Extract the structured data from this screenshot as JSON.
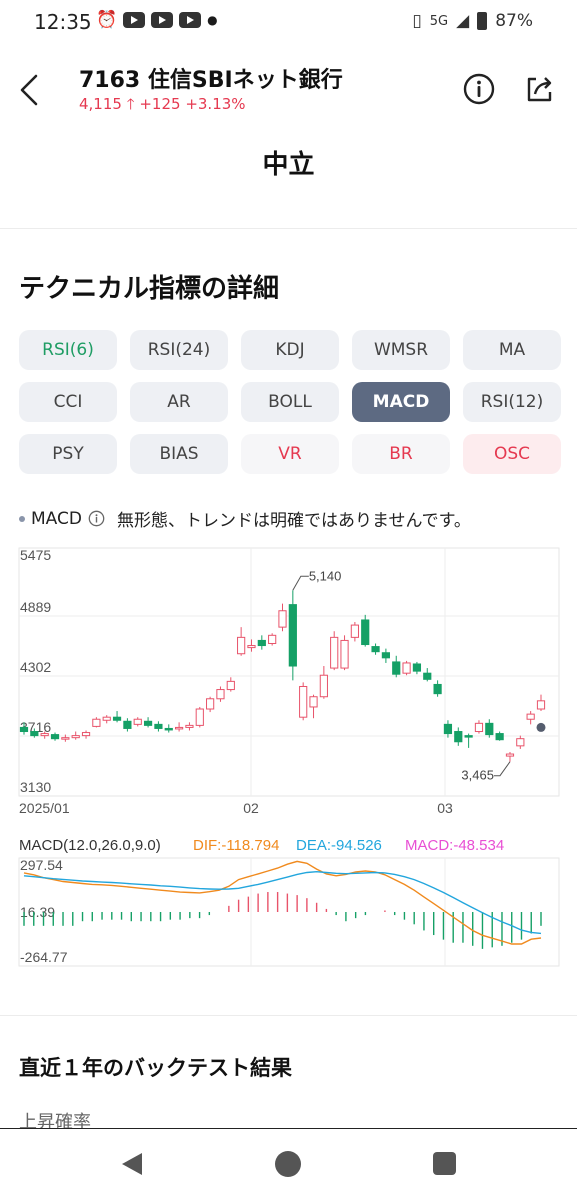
{
  "status_bar": {
    "time": "12:35",
    "network": "5G",
    "battery": "87%"
  },
  "header": {
    "title": "7163 住信SBIネット銀行",
    "price": "4,115",
    "change": "+125",
    "change_pct": "+3.13%",
    "rating": "中立"
  },
  "section_title": "テクニカル指標の詳細",
  "indicators": [
    {
      "label": "RSI(6)",
      "state": "green"
    },
    {
      "label": "RSI(24)",
      "state": "neutral"
    },
    {
      "label": "KDJ",
      "state": "neutral"
    },
    {
      "label": "WMSR",
      "state": "neutral"
    },
    {
      "label": "MA",
      "state": "neutral"
    },
    {
      "label": "CCI",
      "state": "neutral"
    },
    {
      "label": "AR",
      "state": "neutral"
    },
    {
      "label": "BOLL",
      "state": "neutral"
    },
    {
      "label": "MACD",
      "state": "active"
    },
    {
      "label": "RSI(12)",
      "state": "neutral"
    },
    {
      "label": "PSY",
      "state": "neutral"
    },
    {
      "label": "BIAS",
      "state": "neutral"
    },
    {
      "label": "VR",
      "state": "red"
    },
    {
      "label": "BR",
      "state": "red"
    },
    {
      "label": "OSC",
      "state": "pink"
    }
  ],
  "macd_status": {
    "name": "MACD",
    "text": "無形態、トレンドは明確ではありませんです。"
  },
  "chart_data": [
    {
      "type": "candlestick",
      "y_ticks": [
        "5475",
        "4889",
        "4302",
        "3716",
        "3130"
      ],
      "ylim": [
        3130,
        5475
      ],
      "x_ticks": [
        "2025/01",
        "02",
        "03"
      ],
      "annotations": [
        {
          "text": "5,140",
          "value": 5140
        },
        {
          "text": "3,465",
          "value": 3465
        }
      ],
      "colors": {
        "up": "#e8536a",
        "down": "#15a066"
      },
      "candles": [
        {
          "o": 3800,
          "h": 3850,
          "l": 3730,
          "c": 3760
        },
        {
          "o": 3760,
          "h": 3790,
          "l": 3700,
          "c": 3720
        },
        {
          "o": 3720,
          "h": 3760,
          "l": 3690,
          "c": 3740
        },
        {
          "o": 3730,
          "h": 3750,
          "l": 3670,
          "c": 3690
        },
        {
          "o": 3690,
          "h": 3730,
          "l": 3660,
          "c": 3700
        },
        {
          "o": 3700,
          "h": 3760,
          "l": 3680,
          "c": 3720
        },
        {
          "o": 3720,
          "h": 3770,
          "l": 3690,
          "c": 3750
        },
        {
          "o": 3810,
          "h": 3900,
          "l": 3800,
          "c": 3880
        },
        {
          "o": 3870,
          "h": 3920,
          "l": 3840,
          "c": 3900
        },
        {
          "o": 3900,
          "h": 3960,
          "l": 3850,
          "c": 3870
        },
        {
          "o": 3860,
          "h": 3890,
          "l": 3760,
          "c": 3790
        },
        {
          "o": 3830,
          "h": 3900,
          "l": 3810,
          "c": 3880
        },
        {
          "o": 3860,
          "h": 3900,
          "l": 3800,
          "c": 3820
        },
        {
          "o": 3830,
          "h": 3860,
          "l": 3760,
          "c": 3790
        },
        {
          "o": 3790,
          "h": 3830,
          "l": 3750,
          "c": 3780
        },
        {
          "o": 3790,
          "h": 3850,
          "l": 3760,
          "c": 3800
        },
        {
          "o": 3800,
          "h": 3850,
          "l": 3770,
          "c": 3820
        },
        {
          "o": 3820,
          "h": 4000,
          "l": 3800,
          "c": 3980
        },
        {
          "o": 3980,
          "h": 4100,
          "l": 3950,
          "c": 4080
        },
        {
          "o": 4080,
          "h": 4200,
          "l": 4050,
          "c": 4170
        },
        {
          "o": 4170,
          "h": 4290,
          "l": 4150,
          "c": 4250
        },
        {
          "o": 4520,
          "h": 4780,
          "l": 4500,
          "c": 4680
        },
        {
          "o": 4580,
          "h": 4660,
          "l": 4540,
          "c": 4600
        },
        {
          "o": 4650,
          "h": 4700,
          "l": 4560,
          "c": 4600
        },
        {
          "o": 4620,
          "h": 4720,
          "l": 4600,
          "c": 4700
        },
        {
          "o": 4780,
          "h": 5010,
          "l": 4740,
          "c": 4940
        },
        {
          "o": 5000,
          "h": 5140,
          "l": 4260,
          "c": 4400
        },
        {
          "o": 3900,
          "h": 4240,
          "l": 3870,
          "c": 4200
        },
        {
          "o": 4000,
          "h": 4120,
          "l": 3890,
          "c": 4100
        },
        {
          "o": 4100,
          "h": 4400,
          "l": 4080,
          "c": 4310
        },
        {
          "o": 4380,
          "h": 4740,
          "l": 4360,
          "c": 4680
        },
        {
          "o": 4380,
          "h": 4700,
          "l": 4360,
          "c": 4650
        },
        {
          "o": 4680,
          "h": 4830,
          "l": 4640,
          "c": 4800
        },
        {
          "o": 4850,
          "h": 4900,
          "l": 4590,
          "c": 4610
        },
        {
          "o": 4590,
          "h": 4620,
          "l": 4510,
          "c": 4540
        },
        {
          "o": 4530,
          "h": 4570,
          "l": 4430,
          "c": 4480
        },
        {
          "o": 4440,
          "h": 4500,
          "l": 4290,
          "c": 4320
        },
        {
          "o": 4330,
          "h": 4450,
          "l": 4310,
          "c": 4430
        },
        {
          "o": 4420,
          "h": 4440,
          "l": 4320,
          "c": 4350
        },
        {
          "o": 4330,
          "h": 4380,
          "l": 4250,
          "c": 4270
        },
        {
          "o": 4220,
          "h": 4260,
          "l": 4100,
          "c": 4130
        },
        {
          "o": 3830,
          "h": 3870,
          "l": 3700,
          "c": 3740
        },
        {
          "o": 3760,
          "h": 3800,
          "l": 3620,
          "c": 3660
        },
        {
          "o": 3720,
          "h": 3740,
          "l": 3600,
          "c": 3710
        },
        {
          "o": 3760,
          "h": 3870,
          "l": 3740,
          "c": 3840
        },
        {
          "o": 3840,
          "h": 3880,
          "l": 3700,
          "c": 3730
        },
        {
          "o": 3740,
          "h": 3760,
          "l": 3670,
          "c": 3680
        },
        {
          "o": 3520,
          "h": 3560,
          "l": 3465,
          "c": 3540
        },
        {
          "o": 3620,
          "h": 3720,
          "l": 3590,
          "c": 3690
        },
        {
          "o": 3880,
          "h": 3960,
          "l": 3830,
          "c": 3930
        },
        {
          "o": 3980,
          "h": 4120,
          "l": 3960,
          "c": 4060
        }
      ],
      "last_marker": 3800
    },
    {
      "type": "line",
      "title": "MACD(12.0,26.0,9.0)",
      "legend": [
        {
          "label": "DIF:-118.794",
          "color": "#f08a1e"
        },
        {
          "label": "DEA:-94.526",
          "color": "#23a6dd"
        },
        {
          "label": "MACD:-48.534",
          "color": "#e84fd4"
        }
      ],
      "y_ticks": [
        "297.54",
        "16.39",
        "-264.77"
      ],
      "ylim": [
        -264.77,
        297.54
      ],
      "series": [
        {
          "name": "DIF",
          "color": "#f08a1e",
          "values": [
            220,
            210,
            195,
            185,
            175,
            170,
            165,
            160,
            158,
            155,
            150,
            145,
            140,
            135,
            130,
            125,
            120,
            118,
            116,
            122,
            130,
            150,
            185,
            200,
            215,
            230,
            245,
            265,
            280,
            270,
            240,
            215,
            205,
            212,
            225,
            230,
            225,
            210,
            185,
            160,
            130,
            95,
            60,
            25,
            -10,
            -45,
            -80,
            -105,
            -120,
            -135,
            -150,
            -150,
            -125,
            -119
          ]
        },
        {
          "name": "DEA",
          "color": "#23a6dd",
          "values": [
            205,
            200,
            195,
            190,
            186,
            182,
            178,
            175,
            172,
            170,
            167,
            163,
            160,
            157,
            153,
            150,
            146,
            142,
            138,
            136,
            135,
            136,
            140,
            150,
            160,
            172,
            185,
            198,
            212,
            222,
            226,
            222,
            218,
            216,
            218,
            220,
            222,
            220,
            212,
            200,
            185,
            165,
            142,
            118,
            92,
            65,
            38,
            12,
            -12,
            -35,
            -55,
            -78,
            -90,
            -95
          ]
        },
        {
          "name": "MACD",
          "color": "#e84fd4",
          "values": [
            -45,
            -45,
            -45,
            -45,
            -45,
            -45,
            -30,
            -30,
            -25,
            -25,
            -25,
            -30,
            -30,
            -30,
            -30,
            -25,
            -25,
            -20,
            -20,
            -10,
            0,
            20,
            40,
            50,
            60,
            65,
            65,
            60,
            55,
            45,
            30,
            10,
            -10,
            -30,
            -20,
            -10,
            0,
            5,
            -10,
            -25,
            -40,
            -60,
            -75,
            -90,
            -100,
            -100,
            -110,
            -120,
            -115,
            -110,
            -100,
            -90,
            -70,
            -45
          ]
        }
      ],
      "histogram_colors": {
        "pos": "#e8536a",
        "neg": "#15a066"
      }
    }
  ],
  "backtest": {
    "title": "直近１年のバックテスト結果",
    "subtitle": "上昇確率"
  }
}
